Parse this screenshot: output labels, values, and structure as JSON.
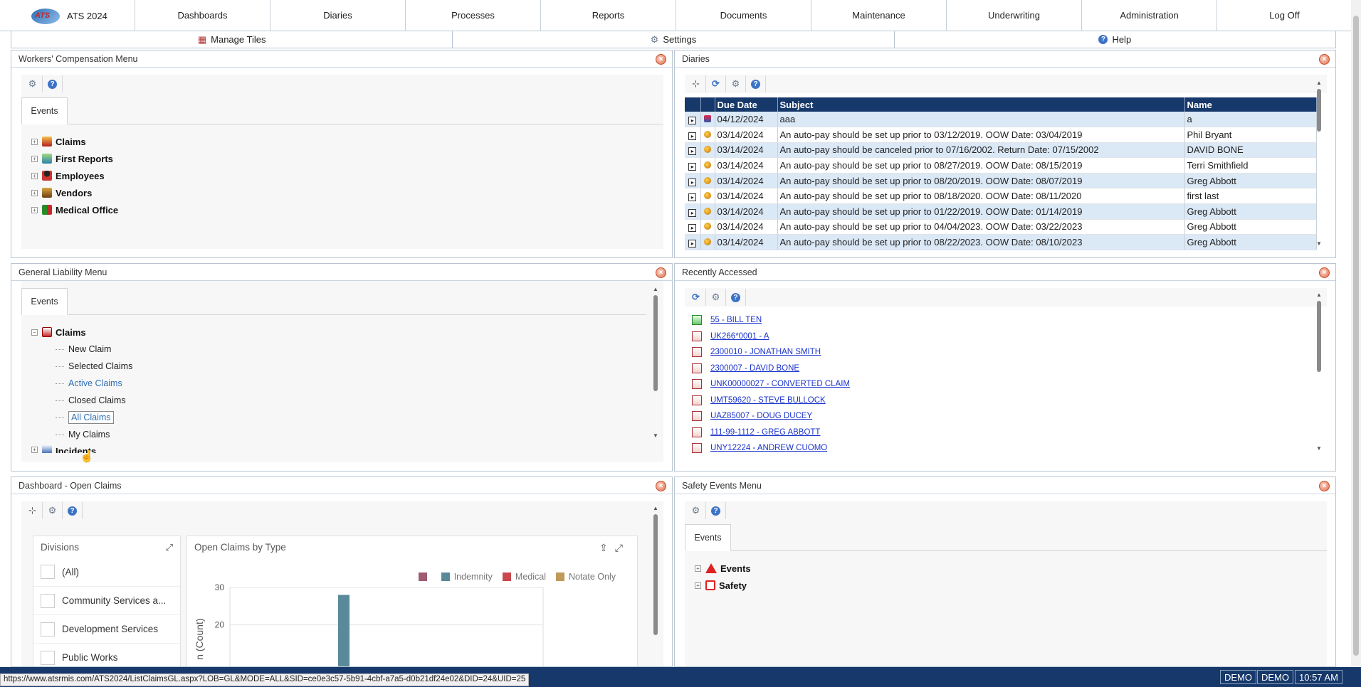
{
  "app": {
    "logo_text": "ATS",
    "title": "ATS 2024"
  },
  "nav": [
    "Dashboards",
    "Diaries",
    "Processes",
    "Reports",
    "Documents",
    "Maintenance",
    "Underwriting",
    "Administration",
    "Log Off"
  ],
  "subbar": {
    "manage_tiles": "Manage Tiles",
    "settings": "Settings",
    "help": "Help"
  },
  "wc_menu": {
    "title": "Workers' Compensation Menu",
    "tab": "Events",
    "nodes": [
      "Claims",
      "First Reports",
      "Employees",
      "Vendors",
      "Medical Office"
    ]
  },
  "diaries": {
    "title": "Diaries",
    "columns": [
      "Due Date",
      "Subject",
      "Name"
    ],
    "rows": [
      {
        "date": "04/12/2024",
        "subject": "aaa",
        "name": "a"
      },
      {
        "date": "03/14/2024",
        "subject": "An auto-pay should be set up prior to 03/12/2019. OOW Date: 03/04/2019",
        "name": "Phil Bryant"
      },
      {
        "date": "03/14/2024",
        "subject": "An auto-pay should be canceled prior to 07/16/2002. Return Date: 07/15/2002",
        "name": "DAVID BONE"
      },
      {
        "date": "03/14/2024",
        "subject": "An auto-pay should be set up prior to 08/27/2019. OOW Date: 08/15/2019",
        "name": "Terri Smithfield"
      },
      {
        "date": "03/14/2024",
        "subject": "An auto-pay should be set up prior to 08/20/2019. OOW Date: 08/07/2019",
        "name": "Greg Abbott"
      },
      {
        "date": "03/14/2024",
        "subject": "An auto-pay should be set up prior to 08/18/2020. OOW Date: 08/11/2020",
        "name": "first last"
      },
      {
        "date": "03/14/2024",
        "subject": "An auto-pay should be set up prior to 01/22/2019. OOW Date: 01/14/2019",
        "name": "Greg Abbott"
      },
      {
        "date": "03/14/2024",
        "subject": "An auto-pay should be set up prior to 04/04/2023. OOW Date: 03/22/2023",
        "name": "Greg Abbott"
      },
      {
        "date": "03/14/2024",
        "subject": "An auto-pay should be set up prior to 08/22/2023. OOW Date: 08/10/2023",
        "name": "Greg Abbott"
      }
    ]
  },
  "gl_menu": {
    "title": "General Liability Menu",
    "tab": "Events",
    "claims": "Claims",
    "children": [
      "New Claim",
      "Selected Claims",
      "Active Claims",
      "Closed Claims",
      "All Claims",
      "My Claims"
    ],
    "next_node": "Incidents"
  },
  "recent": {
    "title": "Recently Accessed",
    "items": [
      "55 - BILL TEN",
      "UK266*0001 - A",
      "2300010 - JONATHAN SMITH",
      "2300007 - DAVID BONE",
      "UNK00000027 - CONVERTED CLAIM",
      "UMT59620 - STEVE BULLOCK",
      "UAZ85007 - DOUG DUCEY",
      "111-99-1112 - GREG ABBOTT",
      "UNY12224 - ANDREW CUOMO"
    ]
  },
  "dashboard": {
    "title": "Dashboard - Open Claims",
    "divisions_title": "Divisions",
    "divisions": [
      "(All)",
      "Community Services a...",
      "Development Services",
      "Public Works"
    ],
    "chart_title": "Open Claims by Type",
    "ylabel": "n (Count)"
  },
  "chart_data": {
    "type": "bar",
    "title": "Open Claims by Type",
    "series": [
      {
        "name": "",
        "color": "#a05a72"
      },
      {
        "name": "Indemnity",
        "color": "#5a8a9a"
      },
      {
        "name": "Medical",
        "color": "#c9484e"
      },
      {
        "name": "Notate Only",
        "color": "#c09a5a"
      }
    ],
    "ytick_labels": [
      "30",
      "20"
    ],
    "ylim": [
      0,
      30
    ],
    "visible_bars": [
      {
        "series": "Indemnity",
        "value": 28
      }
    ],
    "grid": true,
    "legend": "top-right"
  },
  "safety": {
    "title": "Safety Events Menu",
    "tab": "Events",
    "nodes": [
      "Events",
      "Safety"
    ]
  },
  "status": {
    "url": "https://www.atsrmis.com/ATS2024/ListClaimsGL.aspx?LOB=GL&MODE=ALL&SID=ce0e3c57-5b91-4cbf-a7a5-d0b21df24e02&DID=24&UID=25",
    "user1": "DEMO",
    "user2": "DEMO",
    "time": "10:57 AM"
  }
}
